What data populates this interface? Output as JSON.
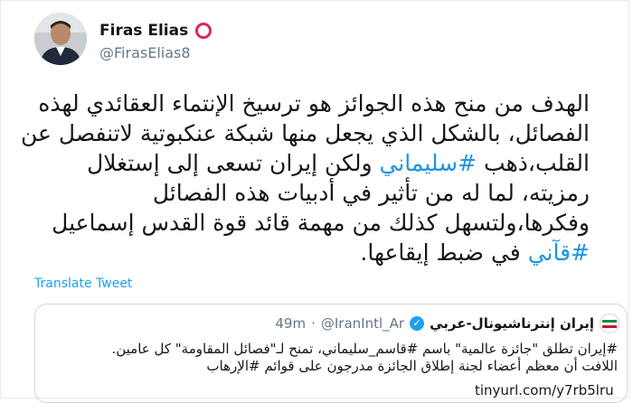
{
  "author": {
    "name": "Firas Elias",
    "handle": "@FirasElias8"
  },
  "tweet": {
    "lines": [
      "الهدف من منح هذه الجوائز هو ترسيخ الإنتماء العقائدي لهذه",
      "الفصائل، بالشكل الذي يجعل منها شبكة عنكبوتية لاتنفصل عن",
      "القلب،ذهب ",
      "رمزيته، لما له من تأثير في أدبيات هذه الفصائل",
      "وفكرها،ولتسهل كذلك من مهمة قائد قوة القدس إسماعيل",
      "في ضبط إيقاعها."
    ],
    "line3_hashtag": "#سليماني",
    "line3_rest": " ولكن إيران تسعى إلى إستغلال",
    "line6_hashtag": "#قآني",
    "translate_label": "Translate Tweet"
  },
  "quote": {
    "name": "إيران إنترناشيونال-عربي",
    "handle": "@IranIntl_Ar",
    "separator": "·",
    "time": "49m",
    "lines": [
      "#إيران تطلق \"جائزة عالمية\" باسم #قاسم_سليماني، تمنح لـ\"فصائل المقاومة\" كل عامين.",
      "اللافت أن معظم أعضاء لجنة إطلاق الجائزة مدرجون على قوائم #الإرهاب"
    ],
    "link": "tinyurl.com/y7rb5lru"
  },
  "colors": {
    "link": "#1da1f2",
    "hashtag": "#1b95e0",
    "badge_ring": "#e0245e"
  },
  "icons": {
    "verified": "verified-badge-icon",
    "ring": "circle-badge-icon"
  }
}
